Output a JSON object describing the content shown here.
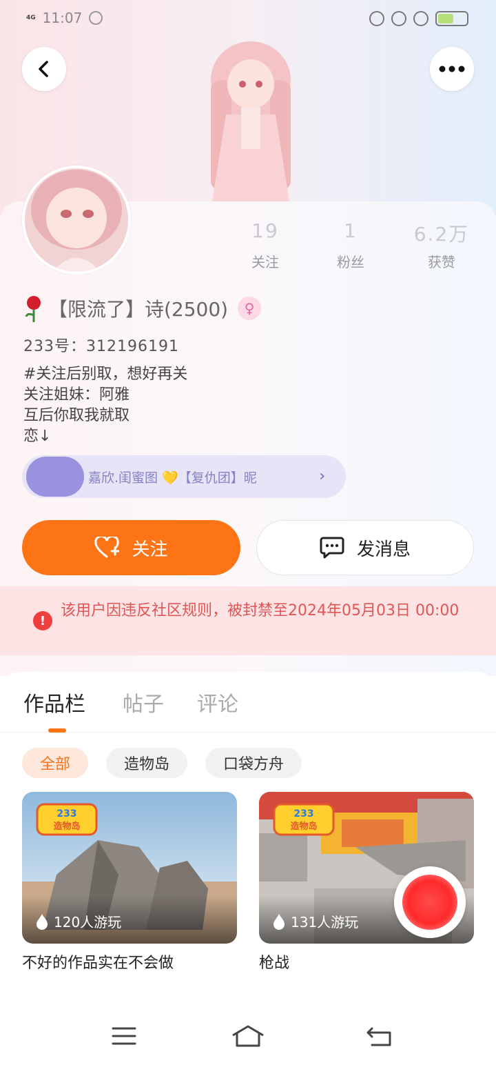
{
  "status_bar": {
    "network": "4G",
    "time": "11:07"
  },
  "profile": {
    "stats": [
      {
        "value": "19",
        "label": "关注"
      },
      {
        "value": "1",
        "label": "粉丝"
      },
      {
        "value": "6.2万",
        "label": "获赞"
      }
    ],
    "username": "【限流了】诗(2500)",
    "uid": "233号：312196191",
    "bio": [
      "#关注后别取，想好再关",
      "关注姐妹：阿雅",
      "互后你取我就取",
      "恋↓"
    ],
    "guild_text": "嘉欣.闺蜜图 💛【复仇团】昵",
    "follow_label": "关注",
    "message_label": "发消息"
  },
  "ban_notice": "该用户因违反社区规则，被封禁至2024年05月03日 00:00",
  "tabs": [
    "作品栏",
    "帖子",
    "评论"
  ],
  "filters": [
    "全部",
    "造物岛",
    "口袋方舟"
  ],
  "works": [
    {
      "badge": "233造物岛",
      "plays": "120人游玩",
      "title": "不好的作品实在不会做"
    },
    {
      "badge": "233造物岛",
      "plays": "131人游玩",
      "title": "枪战"
    }
  ],
  "float_avatar_count": "27",
  "colors": {
    "accent": "#fd7417",
    "ban_bg": "#fde3e3",
    "ban_text": "#e05555"
  }
}
